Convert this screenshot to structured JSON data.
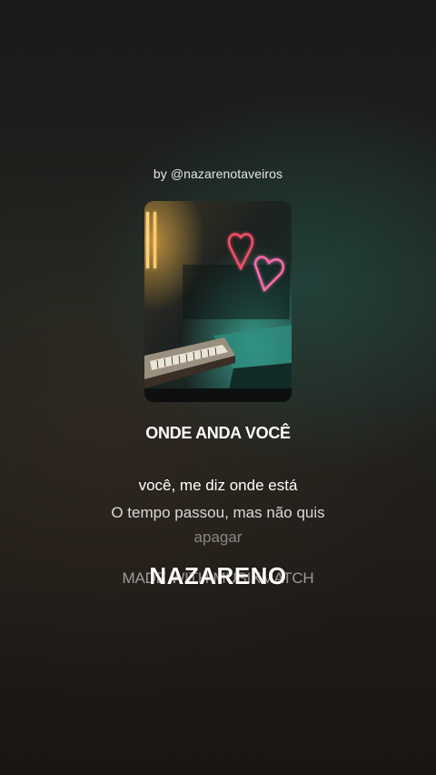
{
  "byline": "by @nazarenotaveiros",
  "cover": {
    "art": "neon-hearts-piano-room"
  },
  "song": {
    "title": "ONDE ANDA VOCÊ"
  },
  "lyrics": {
    "current": "você, me diz onde está",
    "next": "O tempo passou, mas não quis",
    "faded": "apagar",
    "ghost": "MADE WITH MUSIXMATCH"
  },
  "artist": "NAZARENO",
  "colors": {
    "neon_red": "#ff4f6a",
    "neon_pink": "#ff6fb0",
    "teal_glow": "#2a7d70"
  }
}
